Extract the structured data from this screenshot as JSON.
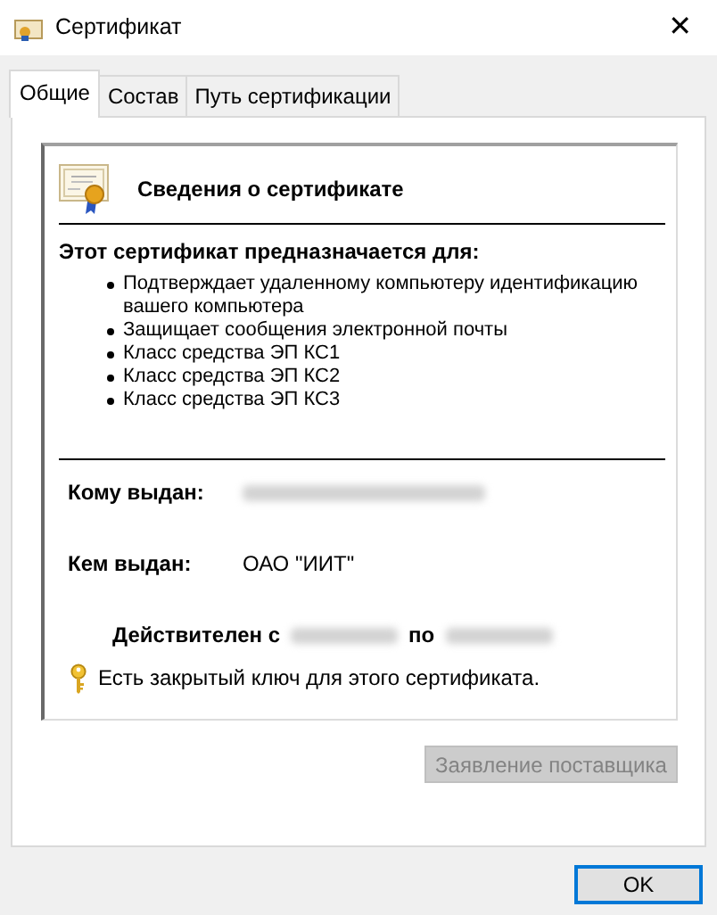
{
  "window": {
    "title": "Сертификат",
    "close": "✕"
  },
  "tabs": [
    {
      "label": "Общие",
      "selected": true
    },
    {
      "label": "Состав",
      "selected": false
    },
    {
      "label": "Путь сертификации",
      "selected": false
    }
  ],
  "info": {
    "heading": "Сведения о сертификате",
    "purpose_title": "Этот сертификат предназначается для:",
    "purposes": [
      "Подтверждает удаленному компьютеру идентификацию вашего компьютера",
      "Защищает сообщения электронной почты",
      "Класс средства ЭП КС1",
      "Класс средства ЭП КС2",
      "Класс средства ЭП КС3"
    ],
    "fields": [
      {
        "label": "Кому выдан:",
        "redacted": true
      },
      {
        "label": "Кем выдан:",
        "value": "ОАО \"ИИТ\"",
        "redacted": false
      }
    ],
    "validity": {
      "from_label": "Действителен с",
      "to_label": "по",
      "from_redacted": true,
      "to_redacted": true
    },
    "key_note": "Есть закрытый ключ для этого сертификата."
  },
  "issuer_button": {
    "label": "Заявление поставщика",
    "disabled": true
  },
  "ok_button": {
    "label": "OK",
    "focused": true
  }
}
